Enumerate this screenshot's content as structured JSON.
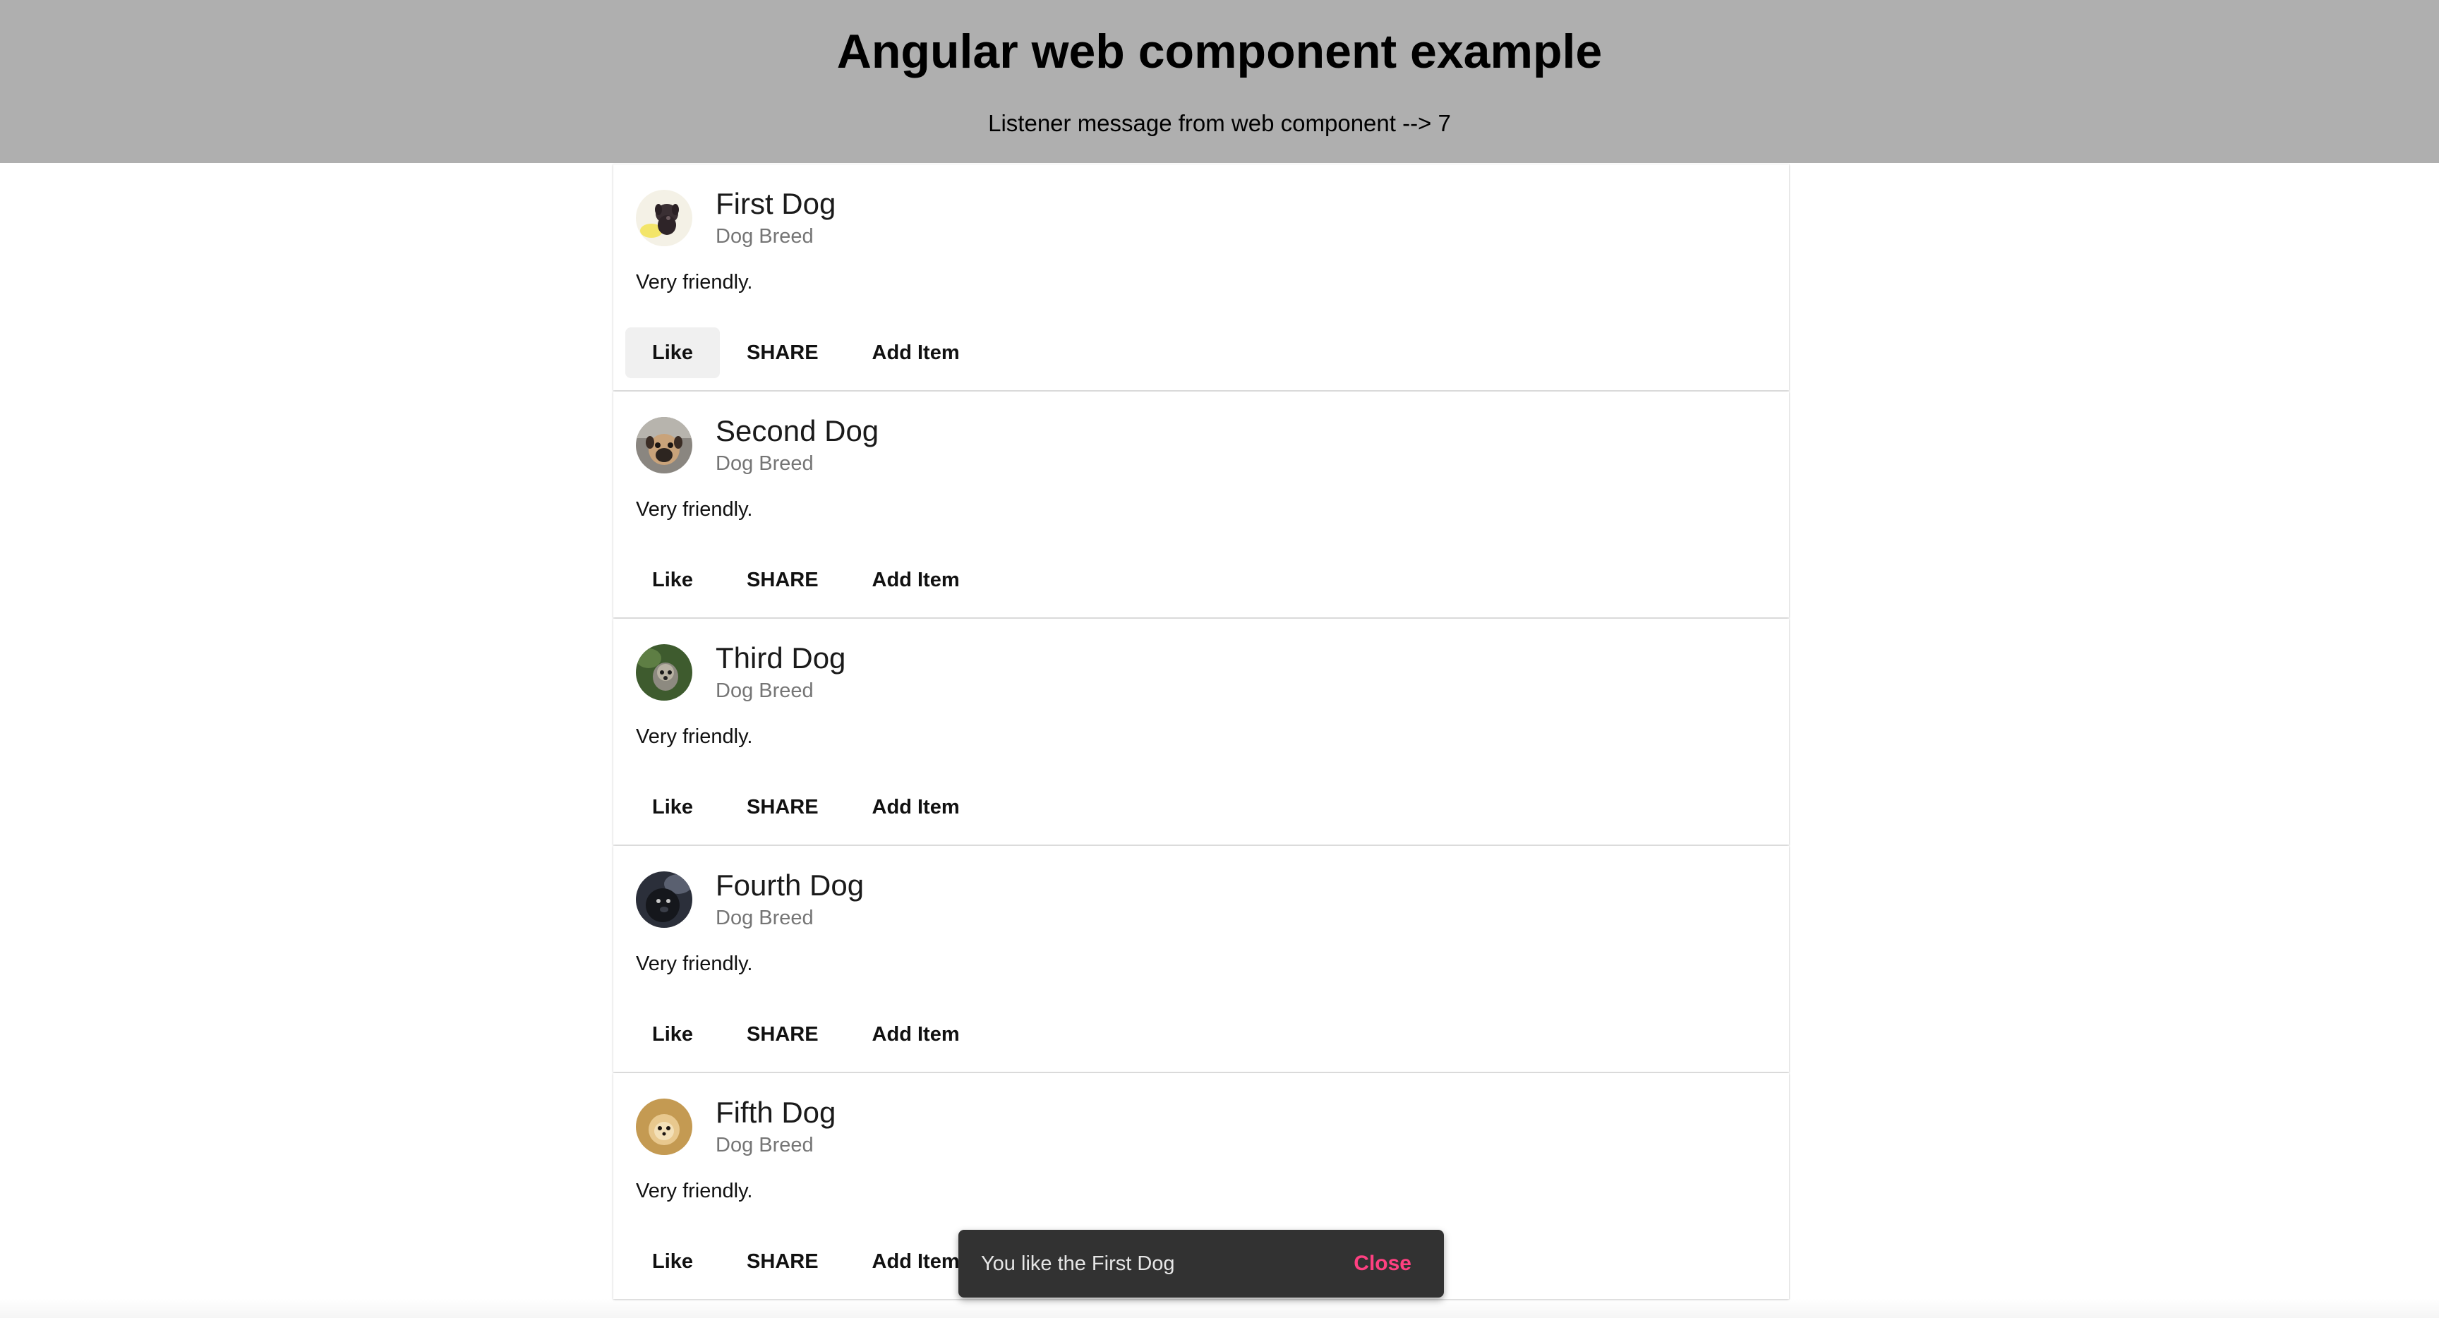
{
  "header": {
    "title": "Angular web component example",
    "message": "Listener message from web component --> 7"
  },
  "cards": [
    {
      "title": "First Dog",
      "subtitle": "Dog Breed",
      "content": "Very friendly.",
      "like": "Like",
      "share": "SHARE",
      "add": "Add Item",
      "avatar_icon": "dog-avatar-black-puppy"
    },
    {
      "title": "Second Dog",
      "subtitle": "Dog Breed",
      "content": "Very friendly.",
      "like": "Like",
      "share": "SHARE",
      "add": "Add Item",
      "avatar_icon": "dog-avatar-pug"
    },
    {
      "title": "Third Dog",
      "subtitle": "Dog Breed",
      "content": "Very friendly.",
      "like": "Like",
      "share": "SHARE",
      "add": "Add Item",
      "avatar_icon": "dog-avatar-terrier"
    },
    {
      "title": "Fourth Dog",
      "subtitle": "Dog Breed",
      "content": "Very friendly.",
      "like": "Like",
      "share": "SHARE",
      "add": "Add Item",
      "avatar_icon": "dog-avatar-dark"
    },
    {
      "title": "Fifth Dog",
      "subtitle": "Dog Breed",
      "content": "Very friendly.",
      "like": "Like",
      "share": "SHARE",
      "add": "Add Item",
      "avatar_icon": "dog-avatar-pomeranian"
    }
  ],
  "snackbar": {
    "text": "You like the First Dog",
    "action": "Close",
    "action_color": "#ff4081"
  },
  "colors": {
    "header_bg": "#afafaf",
    "snackbar_bg": "#323232"
  }
}
